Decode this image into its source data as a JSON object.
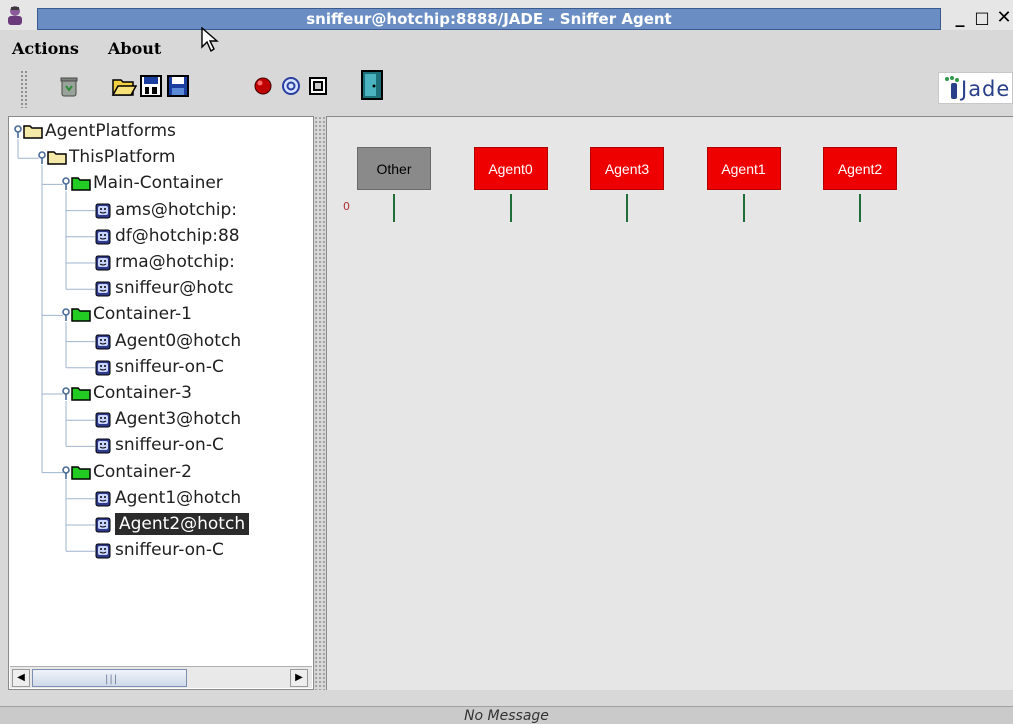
{
  "window": {
    "title": "sniffeur@hotchip:8888/JADE - Sniffer Agent",
    "minimize_glyph": "_",
    "maximize_glyph": "□",
    "close_glyph": "✕"
  },
  "menubar": {
    "items": [
      {
        "label": "Actions"
      },
      {
        "label": "About"
      }
    ]
  },
  "toolbar": {
    "buttons": [
      {
        "icon": "trash-icon"
      },
      {
        "icon": "open-folder-icon"
      },
      {
        "icon": "save-as-icon"
      },
      {
        "icon": "save-icon"
      },
      {
        "icon": "record-icon"
      },
      {
        "icon": "sniff-icon"
      },
      {
        "icon": "message-icon"
      },
      {
        "icon": "exit-door-icon"
      }
    ],
    "logo_text": "Jade"
  },
  "tree": {
    "nodes": [
      {
        "label": "AgentPlatforms",
        "type": "folder"
      },
      {
        "label": "ThisPlatform",
        "type": "folder"
      },
      {
        "label": "Main-Container",
        "type": "container"
      },
      {
        "label": "ams@hotchip:",
        "type": "agent"
      },
      {
        "label": "df@hotchip:88",
        "type": "agent"
      },
      {
        "label": "rma@hotchip:",
        "type": "agent"
      },
      {
        "label": "sniffeur@hotc",
        "type": "agent"
      },
      {
        "label": "Container-1",
        "type": "container"
      },
      {
        "label": "Agent0@hotch",
        "type": "agent"
      },
      {
        "label": "sniffeur-on-C",
        "type": "agent"
      },
      {
        "label": "Container-3",
        "type": "container"
      },
      {
        "label": "Agent3@hotch",
        "type": "agent"
      },
      {
        "label": "sniffeur-on-C",
        "type": "agent"
      },
      {
        "label": "Container-2",
        "type": "container"
      },
      {
        "label": "Agent1@hotch",
        "type": "agent"
      },
      {
        "label": "Agent2@hotch",
        "type": "agent",
        "selected": true
      },
      {
        "label": "sniffeur-on-C",
        "type": "agent"
      }
    ]
  },
  "sniffer": {
    "agents": [
      {
        "label": "Other",
        "color": "#8a8a8a"
      },
      {
        "label": "Agent0",
        "color": "#ee0000"
      },
      {
        "label": "Agent3",
        "color": "#ee0000"
      },
      {
        "label": "Agent1",
        "color": "#ee0000"
      },
      {
        "label": "Agent2",
        "color": "#ee0000"
      }
    ],
    "message_index_label": "0"
  },
  "status": {
    "text": "No Message"
  },
  "colors": {
    "title_strip": "#6a8ec4",
    "agent_box": "#ee0000",
    "other_box": "#8a8a8a",
    "container_folder": "#22cc22",
    "lifeline": "#1f6e3a"
  }
}
